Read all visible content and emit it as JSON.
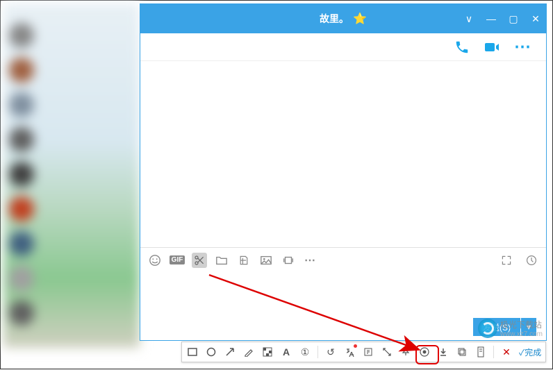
{
  "window": {
    "title": "故里。",
    "star": "⭐"
  },
  "win_controls": {
    "dropdown": "∨",
    "minimize": "—",
    "maximize": "▢",
    "close": "✕"
  },
  "call_bar": {
    "phone": "phone-icon",
    "video": "video-icon",
    "more": "⋯"
  },
  "input_toolbar": {
    "emoji": "☺",
    "gif": "GIF",
    "scissors": "✂",
    "folder": "📁",
    "quote": "❝",
    "image": "🖼",
    "shake": "📳",
    "more": "⋯",
    "expand": "⤢",
    "history": "🕘"
  },
  "send": {
    "label": "发送(S)",
    "dropdown": "▾"
  },
  "anno_toolbar": {
    "rect": "▭",
    "circle": "○",
    "arrow": "➜",
    "brush": "✎",
    "mosaic": "▦",
    "text": "A",
    "number": "①",
    "sep1": "|",
    "undo": "↺",
    "translate": "⦻",
    "ocr": "囧",
    "extract": "⟐",
    "pin": "📌",
    "record": "◉",
    "download": "⬇",
    "copy": "▭",
    "long": "▯",
    "sep2": "|",
    "cancel": "✕",
    "done": "✓完成"
  },
  "watermark": {
    "text": "极光下载站",
    "url": "www.xz7.com"
  }
}
